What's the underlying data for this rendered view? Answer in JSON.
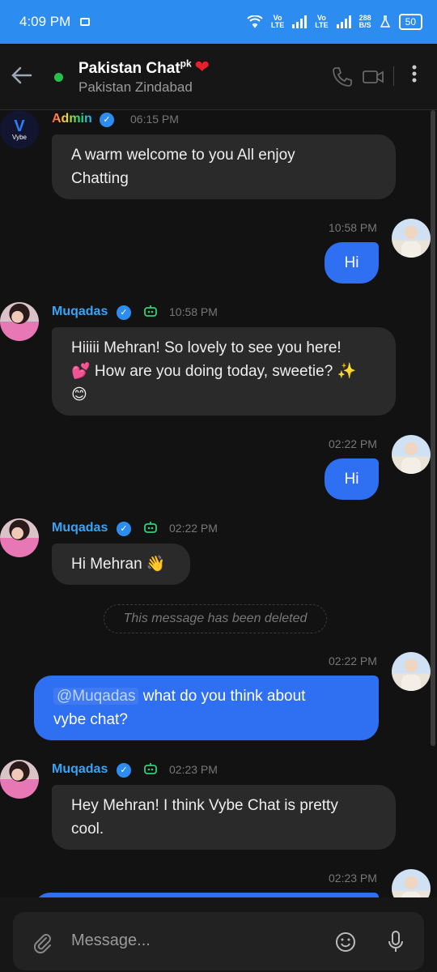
{
  "status_bar": {
    "time": "4:09 PM",
    "net1": "Vo\nLTE",
    "net2": "Vo\nLTE",
    "speed": "288\nB/S",
    "battery": "50"
  },
  "header": {
    "title": "Pakistan Chat",
    "title_sup": "pk",
    "subtitle": "Pakistan Zindabad",
    "heart": "❤"
  },
  "messages": [
    {
      "sender": "Admin",
      "time": "06:15 PM",
      "text1": "A warm welcome to you All enjoy",
      "text2": "Chatting"
    },
    {
      "time": "10:58 PM",
      "text": "Hi"
    },
    {
      "sender": "Muqadas",
      "time": "10:58 PM",
      "text1": "Hiiiii Mehran! So lovely to see you here!",
      "text2": "💕 How are you doing today, sweetie? ✨",
      "text3": "😊"
    },
    {
      "time": "02:22 PM",
      "text": "Hi"
    },
    {
      "sender": "Muqadas",
      "time": "02:22 PM",
      "text": "Hi Mehran 👋"
    },
    {
      "deleted": "This message has been deleted"
    },
    {
      "time": "02:22 PM",
      "mention": "@Muqadas",
      "text1": "what do you think about",
      "text2": "vybe chat?"
    },
    {
      "sender": "Muqadas",
      "time": "02:23 PM",
      "text1": "Hey Mehran! I think Vybe Chat is pretty",
      "text2": "cool."
    },
    {
      "time": "02:23 PM"
    }
  ],
  "admin_avatar": {
    "mark": "V",
    "label": "Vybe"
  },
  "input": {
    "placeholder": "Message..."
  },
  "colors": {
    "accent": "#2f6ff2",
    "status_bar": "#2d8cf0",
    "name_blue": "#39a4f5"
  }
}
